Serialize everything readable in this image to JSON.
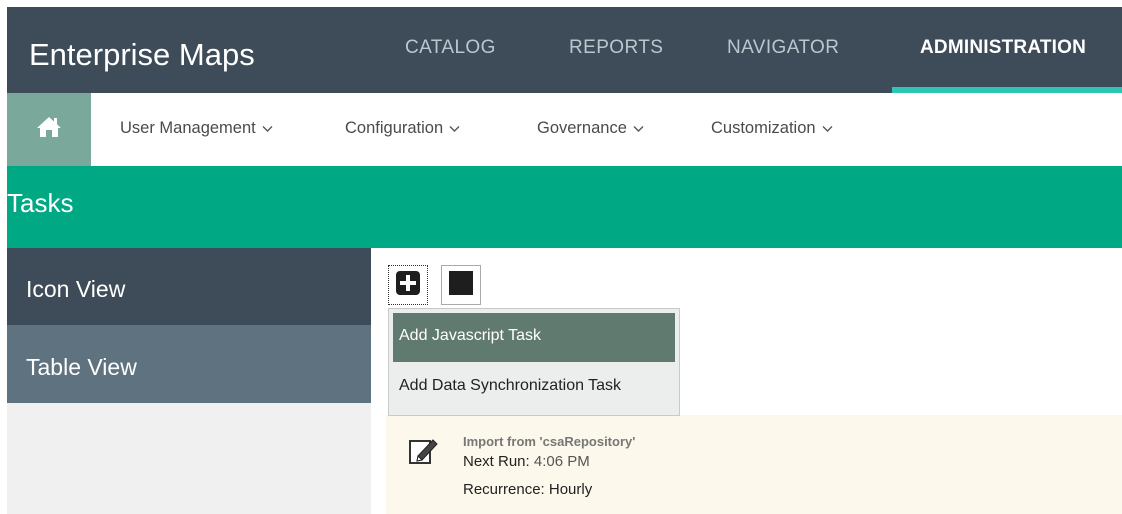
{
  "app": {
    "title": "Enterprise Maps"
  },
  "top_nav": {
    "items": [
      {
        "label": "CATALOG"
      },
      {
        "label": "REPORTS"
      },
      {
        "label": "NAVIGATOR"
      },
      {
        "label": "ADMINISTRATION",
        "active": true
      }
    ]
  },
  "sub_nav": {
    "home_icon": "home-icon",
    "items": [
      {
        "label": "User Management"
      },
      {
        "label": "Configuration"
      },
      {
        "label": "Governance"
      },
      {
        "label": "Customization"
      }
    ]
  },
  "page": {
    "title": "Tasks"
  },
  "sidebar": {
    "items": [
      {
        "label": "Icon View"
      },
      {
        "label": "Table View"
      }
    ]
  },
  "toolbar": {
    "add_icon": "plus-square-icon",
    "stop_icon": "stop-square-icon"
  },
  "add_menu": {
    "items": [
      {
        "label": "Add Javascript Task",
        "highlighted": true
      },
      {
        "label": "Add Data Synchronization Task"
      }
    ]
  },
  "task": {
    "icon": "edit-icon",
    "title": "Import from 'csaRepository'",
    "next_run_label": "Next Run:",
    "next_run_value": "4:06 PM",
    "recurrence_label": "Recurrence:",
    "recurrence_value": "Hourly"
  },
  "colors": {
    "header": "#3e4c59",
    "accent_teal": "#2ec4b6",
    "banner_green": "#00a884",
    "home_button": "#7aa99c",
    "menu_highlight": "#617a70",
    "task_card": "#fdf8ec"
  }
}
